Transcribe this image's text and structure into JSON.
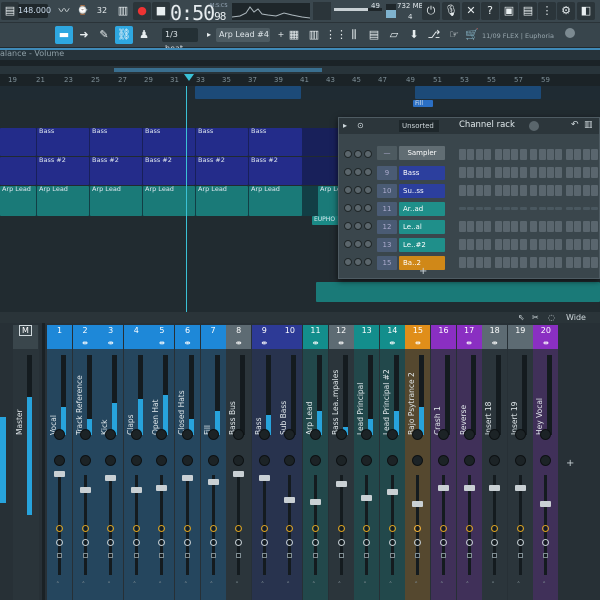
{
  "toolbar": {
    "tempo": "148.000",
    "pattern_mode": "32",
    "time": "0:50",
    "time_small": "98",
    "time_unit": "M:S:CS",
    "volume_readout": "49",
    "ram": "732 MB",
    "cpu": "4",
    "snap": "1/3 beat",
    "pattern": "Arp Lead #4",
    "hint": "11/09 FLEX | Euphoria"
  },
  "playlist": {
    "automation_label": "alance - Volume",
    "ruler": [
      "19",
      "21",
      "23",
      "25",
      "27",
      "29",
      "31",
      "33",
      "35",
      "37",
      "39",
      "41",
      "43",
      "45",
      "47",
      "49",
      "51",
      "53",
      "55",
      "57",
      "59"
    ],
    "clips": {
      "bass": "Bass",
      "bass2": "Bass #2",
      "arp": "Arp Lead",
      "fill": "Fill",
      "euphoria": "EUPHO"
    }
  },
  "channel_rack": {
    "filter": "Unsorted",
    "title": "Channel rack",
    "sampler": "Sampler",
    "channels": [
      {
        "num": "9",
        "name": "Bass",
        "color": "#2c3f9e"
      },
      {
        "num": "10",
        "name": "Su..ss",
        "color": "#2c3f9e"
      },
      {
        "num": "11",
        "name": "Ar..ad",
        "color": "#1f8f8a"
      },
      {
        "num": "12",
        "name": "Le..al",
        "color": "#1f8f8a"
      },
      {
        "num": "13",
        "name": "Le..#2",
        "color": "#1f8f8a"
      },
      {
        "num": "15",
        "name": "Ba..2",
        "color": "#d08818"
      }
    ]
  },
  "mixer": {
    "wide": "Wide",
    "master": {
      "num": "M",
      "name": "Master"
    },
    "tracks": [
      {
        "num": "1",
        "name": "Vocal",
        "color": "#1e88d8"
      },
      {
        "num": "2",
        "name": "Track Reference",
        "color": "#1e88d8"
      },
      {
        "num": "3",
        "name": "Kick",
        "color": "#1e88d8"
      },
      {
        "num": "4",
        "name": "Claps",
        "color": "#1e88d8"
      },
      {
        "num": "5",
        "name": "Open Hat",
        "color": "#1e88d8"
      },
      {
        "num": "6",
        "name": "Closed Hats",
        "color": "#1e88d8"
      },
      {
        "num": "7",
        "name": "Fill",
        "color": "#1e88d8"
      },
      {
        "num": "8",
        "name": "Bass Bus",
        "color": "#5d6b73"
      },
      {
        "num": "9",
        "name": "Bass",
        "color": "#2d3a96"
      },
      {
        "num": "10",
        "name": "Sub Bass",
        "color": "#2d3a96"
      },
      {
        "num": "11",
        "name": "Arp Lead",
        "color": "#138e8c"
      },
      {
        "num": "12",
        "name": "Bass Lea..mpales",
        "color": "#5d6b73"
      },
      {
        "num": "13",
        "name": "Lead Principal",
        "color": "#138e8c"
      },
      {
        "num": "14",
        "name": "Lead Principal #2",
        "color": "#138e8c"
      },
      {
        "num": "15",
        "name": "Bajo Psytrance 2",
        "color": "#e08e1a"
      },
      {
        "num": "16",
        "name": "Crash 1",
        "color": "#8a2fc2"
      },
      {
        "num": "17",
        "name": "Reverse",
        "color": "#8a2fc2"
      },
      {
        "num": "18",
        "name": "Insert 18",
        "color": "#5d6b73"
      },
      {
        "num": "19",
        "name": "Insert 19",
        "color": "#5d6b73"
      },
      {
        "num": "20",
        "name": "Hey Vocal",
        "color": "#8a2fc2"
      }
    ]
  }
}
